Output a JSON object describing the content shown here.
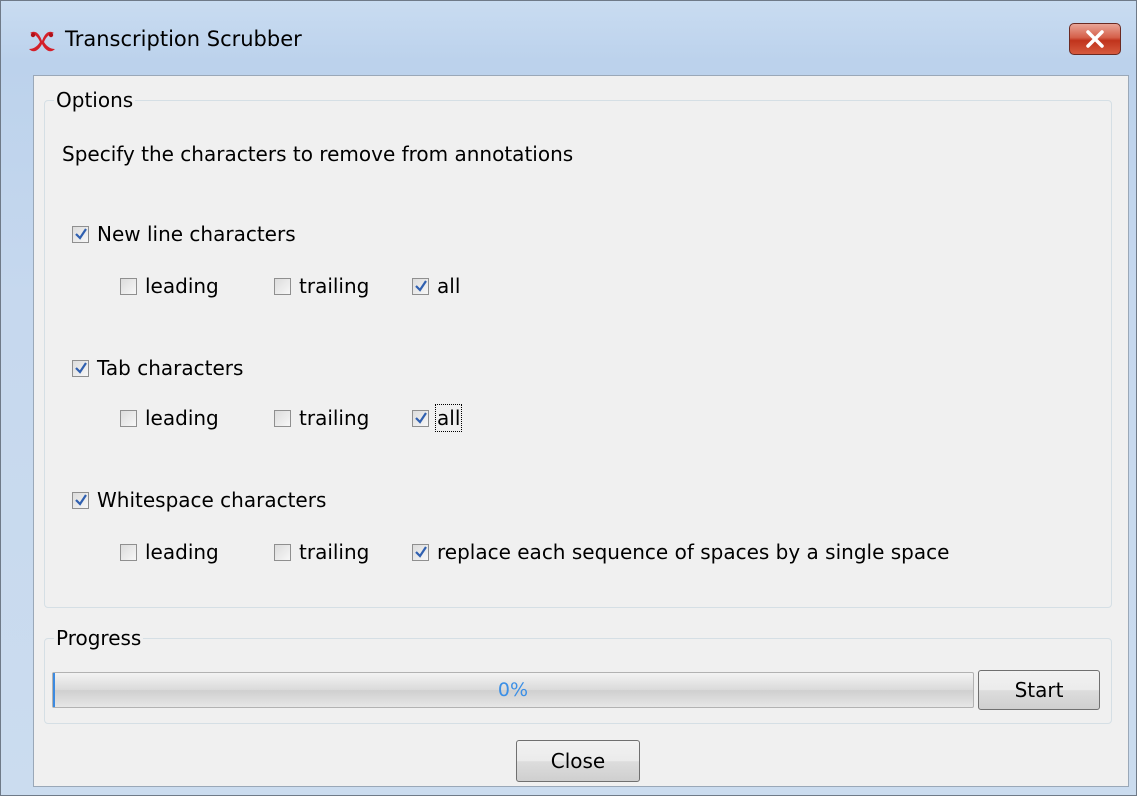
{
  "window": {
    "title": "Transcription Scrubber",
    "icon": "transcription-scrubber-app-icon",
    "close_icon": "close-icon"
  },
  "options": {
    "legend": "Options",
    "instructions": "Specify the characters to remove from annotations",
    "groups": [
      {
        "label": "New line characters",
        "checked": true,
        "sub": [
          {
            "label": "leading",
            "checked": false
          },
          {
            "label": "trailing",
            "checked": false
          },
          {
            "label": "all",
            "checked": true
          }
        ]
      },
      {
        "label": "Tab characters",
        "checked": true,
        "sub": [
          {
            "label": "leading",
            "checked": false
          },
          {
            "label": "trailing",
            "checked": false
          },
          {
            "label": "all",
            "checked": true,
            "focused": true
          }
        ]
      },
      {
        "label": "Whitespace characters",
        "checked": true,
        "sub": [
          {
            "label": "leading",
            "checked": false
          },
          {
            "label": "trailing",
            "checked": false
          },
          {
            "label": "replace each sequence of spaces by a single space",
            "checked": true
          }
        ]
      }
    ]
  },
  "progress": {
    "legend": "Progress",
    "percent": 0,
    "text": "0%",
    "start_label": "Start"
  },
  "footer": {
    "close_label": "Close"
  },
  "colors": {
    "accent": "#3b8fe6",
    "title_close": "#c0331c"
  }
}
